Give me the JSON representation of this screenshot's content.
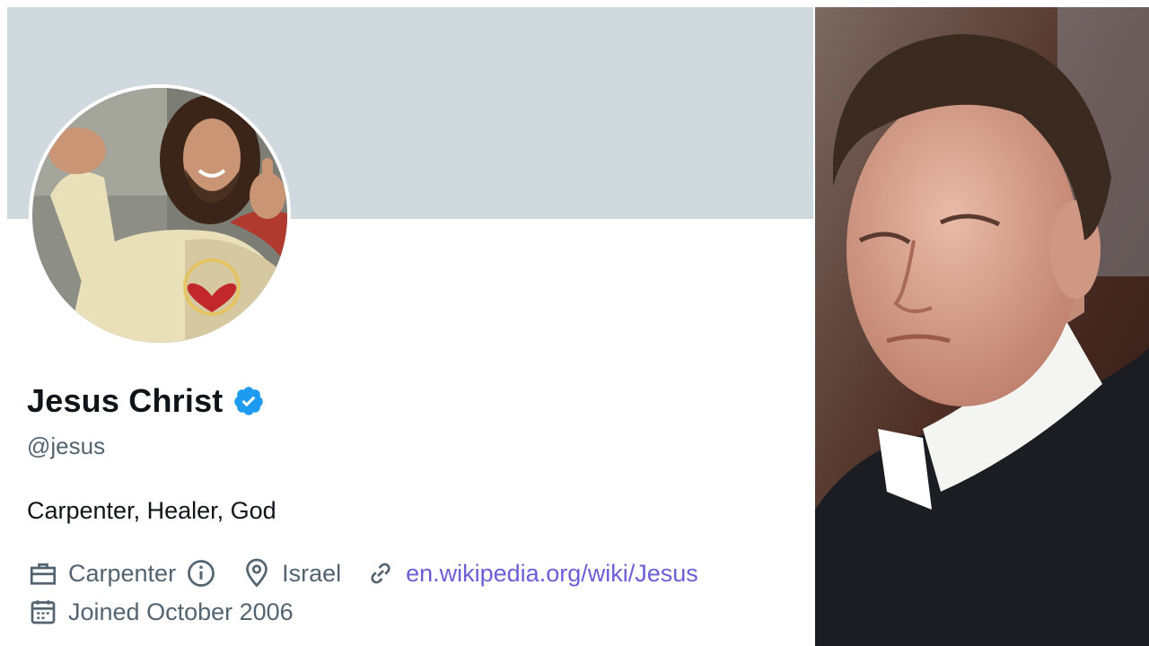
{
  "profile": {
    "name": "Jesus Christ",
    "handle": "@jesus",
    "bio": "Carpenter, Healer, God",
    "profession": "Carpenter",
    "location": "Israel",
    "website": "en.wikipedia.org/wiki/Jesus",
    "joined": "Joined October 2006",
    "verified": true
  },
  "icons": {
    "verified": "verified-badge-icon",
    "profession": "briefcase-icon",
    "info": "info-icon",
    "location": "location-pin-icon",
    "link": "link-icon",
    "calendar": "calendar-icon"
  },
  "colors": {
    "banner": "#cfd9de",
    "verified": "#1d9bf0",
    "link": "#6b5fd6",
    "secondary_text": "#536471",
    "primary_text": "#0f1419"
  }
}
